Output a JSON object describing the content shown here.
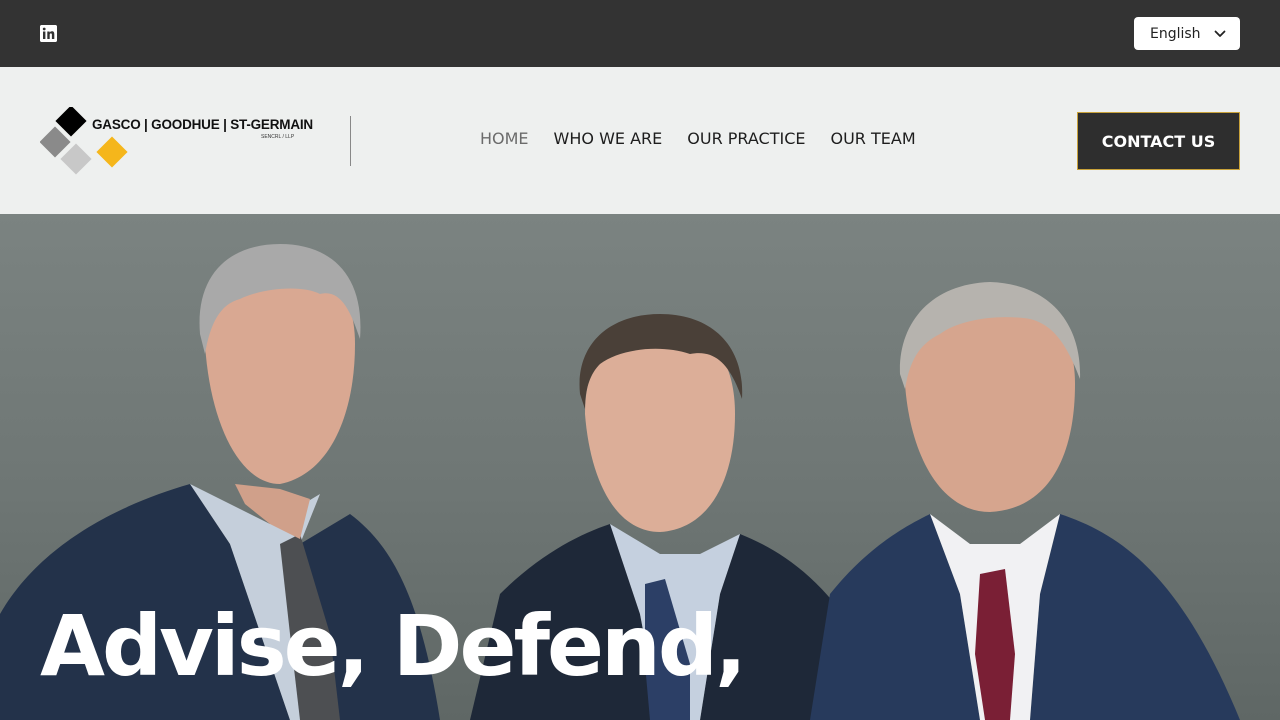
{
  "topbar": {
    "social_icon": "linkedin-icon",
    "language": {
      "selected": "English",
      "icon": "chevron-down-icon"
    }
  },
  "header": {
    "logo": {
      "name": "GASCO | GOODHUE | ST-GERMAIN",
      "suffix": "SENCRL / LLP",
      "colors": [
        "#000000",
        "#8a8a8a",
        "#c8c8c8",
        "#f5b61b"
      ]
    },
    "nav": [
      {
        "label": "HOME",
        "active": true
      },
      {
        "label": "WHO WE ARE",
        "active": false
      },
      {
        "label": "OUR PRACTICE",
        "active": false
      },
      {
        "label": "OUR TEAM",
        "active": false
      }
    ],
    "cta": "CONTACT US"
  },
  "hero": {
    "title": "Advise, Defend,"
  },
  "colors": {
    "topbar_bg": "#333333",
    "header_bg": "#eef0ef",
    "accent": "#c9a23a",
    "button_bg": "#2e2e2e"
  }
}
